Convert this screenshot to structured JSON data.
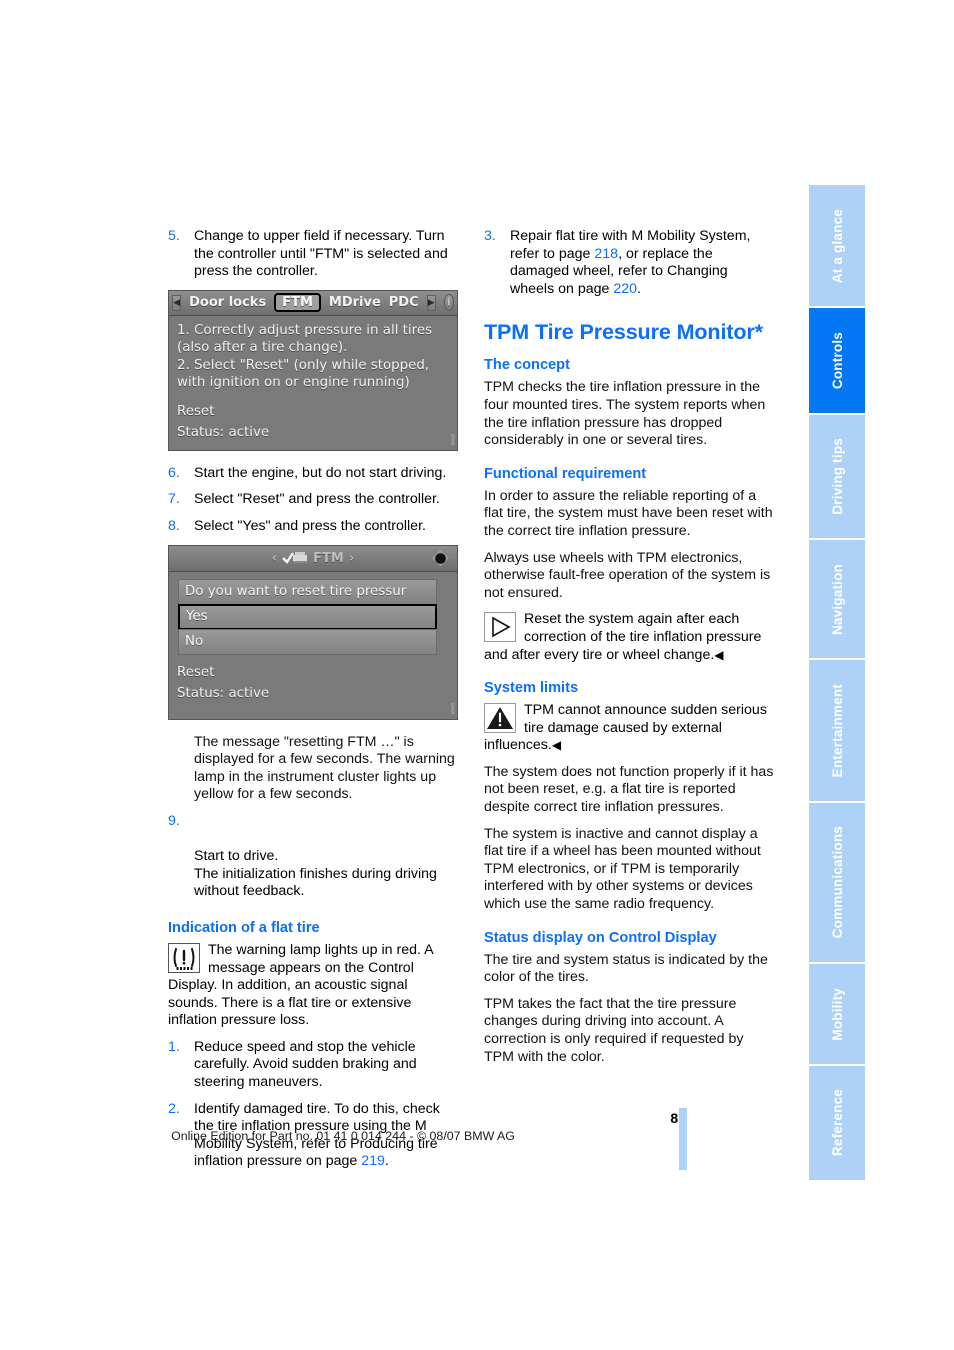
{
  "page": {
    "number": "87",
    "footer_note": "Online Edition for Part no. 01 41 0 014 244 - © 08/07 BMW AG"
  },
  "index_tabs": [
    {
      "label": "At a glance",
      "active": false
    },
    {
      "label": "Controls",
      "active": true
    },
    {
      "label": "Driving tips",
      "active": false
    },
    {
      "label": "Navigation",
      "active": false
    },
    {
      "label": "Entertainment",
      "active": false
    },
    {
      "label": "Communications",
      "active": false
    },
    {
      "label": "Mobility",
      "active": false
    },
    {
      "label": "Reference",
      "active": false
    }
  ],
  "colors": {
    "accent_blue": "#0d6efd",
    "tab_active": "#0477f5",
    "tab_inactive": "#aed2f7"
  },
  "left_column": {
    "step5": {
      "num": "5.",
      "text": "Change to upper field if necessary. Turn the controller until \"FTM\" is selected and press the controller."
    },
    "screenshot_menu": {
      "left_arrow": "◀",
      "items": [
        {
          "label": "Door locks",
          "selected": false
        },
        {
          "label": "FTM",
          "selected": true
        },
        {
          "label": "MDrive",
          "selected": false
        },
        {
          "label": "PDC",
          "selected": false
        }
      ],
      "right_arrow": "▶",
      "info_icon": "i",
      "lines": [
        "1. Correctly adjust pressure in all tires",
        "(also after a tire change).",
        "2. Select \"Reset\" (only while stopped,",
        "with ignition on or engine running)"
      ],
      "reset_label": "Reset",
      "status_label": "Status: active"
    },
    "step6": {
      "num": "6.",
      "text": "Start the engine, but do not start driving."
    },
    "step7": {
      "num": "7.",
      "text": "Select \"Reset\" and press the controller."
    },
    "step8": {
      "num": "8.",
      "text": "Select \"Yes\" and press the controller."
    },
    "screenshot_dialog": {
      "title": "FTM",
      "title_left_arrow": "‹",
      "title_right_arrow": "›",
      "question": "Do you want to reset tire pressur",
      "option_yes": "Yes",
      "option_no": "No",
      "reset_label": "Reset",
      "status_label": "Status:  active"
    },
    "after_dialog_text": "The message \"resetting FTM …\" is displayed for a few seconds. The warning lamp in the instrument cluster lights up yellow for a few seconds.",
    "step9": {
      "num": "9.",
      "text": "Start to drive.\nThe initialization finishes during driving without feedback."
    },
    "heading_flat_tire": "Indication of a flat tire",
    "flat_tire_note": "The warning lamp lights up in red. A message appears on the Control Display. In addition, an acoustic signal sounds. There is a flat tire or extensive inflation pressure loss.",
    "flat_step1": {
      "num": "1.",
      "text": "Reduce speed and stop the vehicle carefully. Avoid sudden braking and steering maneuvers."
    },
    "flat_step2": {
      "num": "2.",
      "text_before": "Identify damaged tire. To do this, check the tire inflation pressure using the M Mobility System, refer to Producing tire inflation pressure on page ",
      "page_ref": "219",
      "text_after": "."
    }
  },
  "right_column": {
    "step3": {
      "num": "3.",
      "part1": "Repair flat tire with M Mobility System, refer to page ",
      "ref1": "218",
      "part2": ", or replace the damaged wheel, refer to Changing wheels on page ",
      "ref2": "220",
      "part3": "."
    },
    "title": "TPM Tire Pressure Monitor*",
    "concept": {
      "heading": "The concept",
      "text": "TPM checks the tire inflation pressure in the four mounted tires. The system reports when the tire inflation pressure has dropped considerably in one or several tires."
    },
    "functional": {
      "heading": "Functional requirement",
      "p1": "In order to assure the reliable reporting of a flat tire, the system must have been reset with the correct tire inflation pressure.",
      "p2": "Always use wheels with TPM electronics, otherwise fault-free operation of the system is not ensured.",
      "note": "Reset the system again after each correction of the tire inflation pressure and after every tire or wheel change.",
      "note_end": "◀"
    },
    "limits": {
      "heading": "System limits",
      "warning": "TPM cannot announce sudden serious tire damage caused by external influences.",
      "warning_end": "◀",
      "p1": "The system does not function properly if it has not been reset, e.g. a flat tire is reported despite correct tire inflation pressures.",
      "p2": "The system is inactive and cannot display a flat tire if a wheel has been mounted without TPM electronics, or if TPM is temporarily interfered with by other systems or devices which use the same radio frequency."
    },
    "status_display": {
      "heading": "Status display on Control Display",
      "p1": "The tire and system status is indicated by the color of the tires.",
      "p2": "TPM takes the fact that the tire pressure changes during driving into account. A correction is only required if requested by TPM with the color."
    }
  }
}
